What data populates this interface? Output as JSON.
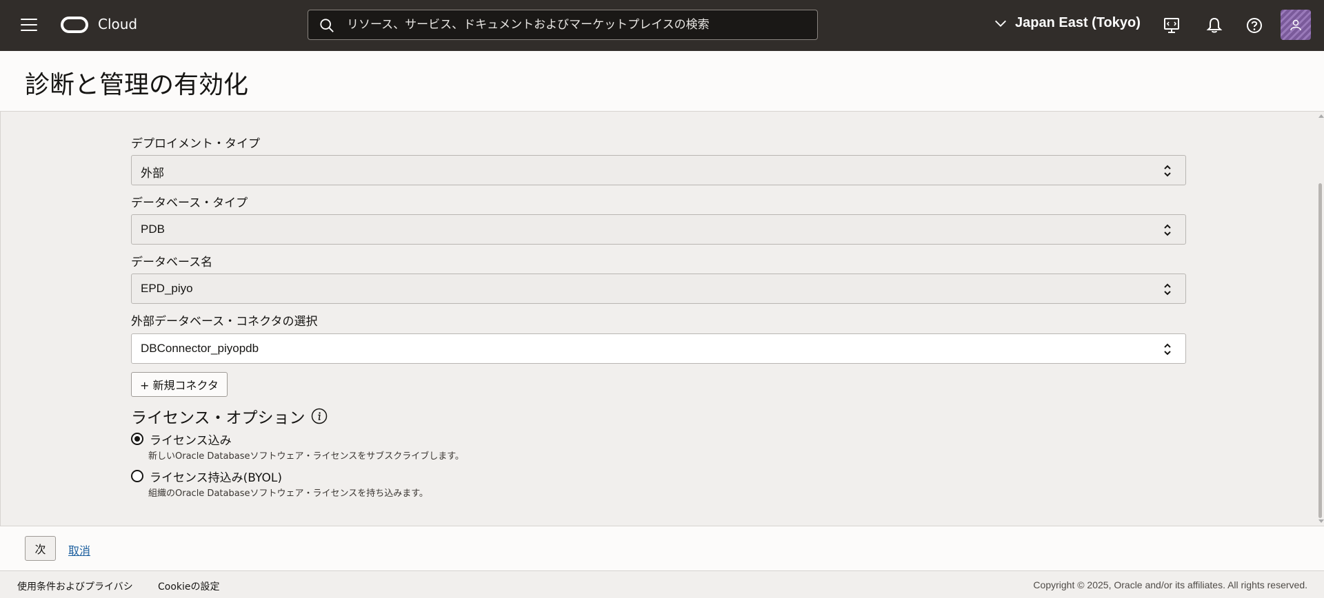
{
  "topbar": {
    "brand": "Cloud",
    "search_placeholder": "リソース、サービス、ドキュメントおよびマーケットプレイスの検索",
    "region": "Japan East (Tokyo)"
  },
  "page": {
    "title": "診断と管理の有効化"
  },
  "form": {
    "deployment_type": {
      "label": "デプロイメント・タイプ",
      "value": "外部"
    },
    "database_type": {
      "label": "データベース・タイプ",
      "value": "PDB"
    },
    "database_name": {
      "label": "データベース名",
      "value": "EPD_piyo"
    },
    "connector": {
      "label": "外部データベース・コネクタの選択",
      "value": "DBConnector_piyopdb"
    },
    "new_connector_button": "+ 新規コネクタ",
    "license": {
      "title": "ライセンス・オプション",
      "options": [
        {
          "label": "ライセンス込み",
          "description": "新しいOracle Databaseソフトウェア・ライセンスをサブスクライブします。",
          "selected": true
        },
        {
          "label": "ライセンス持込み(BYOL)",
          "description": "組織のOracle Databaseソフトウェア・ライセンスを持ち込みます。",
          "selected": false
        }
      ]
    }
  },
  "actions": {
    "next": "次",
    "cancel": "取消"
  },
  "footer": {
    "terms": "使用条件およびプライバシ",
    "cookies": "Cookieの設定",
    "copyright": "Copyright © 2025, Oracle and/or its affiliates. All rights reserved."
  }
}
